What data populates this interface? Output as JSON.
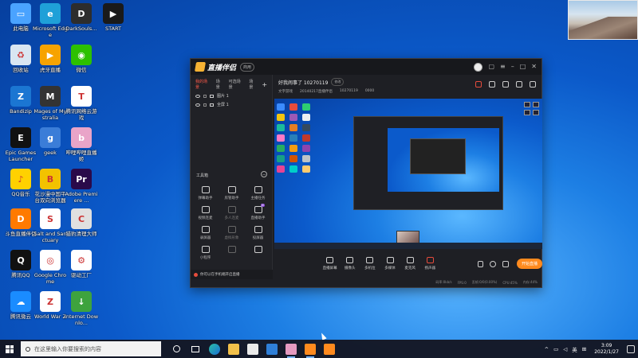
{
  "desktop": {
    "icons": [
      {
        "label": "此电脑",
        "icon": "computer-icon",
        "color": "#4aa3ff"
      },
      {
        "label": "Microsoft Edge",
        "icon": "edge-icon",
        "color": "#1fa0d8"
      },
      {
        "label": "DarkSouls...",
        "icon": "darksouls-icon",
        "color": "#2d2d2d"
      },
      {
        "label": "START",
        "icon": "start-app-icon",
        "color": "#1a1a1a"
      },
      {
        "label": "回收站",
        "icon": "recycle-bin-icon",
        "color": "#d9e6f2"
      },
      {
        "label": "虎牙直播",
        "icon": "huya-icon",
        "color": "#f7a300"
      },
      {
        "label": "微信",
        "icon": "wechat-icon",
        "color": "#2dc100"
      },
      {
        "label": "Bandizip",
        "icon": "bandizip-icon",
        "color": "#1b76d2"
      },
      {
        "label": "Mages of Mystralia",
        "icon": "mages-icon",
        "color": "#333333"
      },
      {
        "label": "腾讯网络云游戏",
        "icon": "tencent-cloud-game-icon",
        "color": "#ffffff"
      },
      {
        "label": "Epic Games Launcher",
        "icon": "epic-games-icon",
        "color": "#111111"
      },
      {
        "label": "geek",
        "icon": "geek-icon",
        "color": "#3b7dd8"
      },
      {
        "label": "哔哩哔哩直播姬",
        "icon": "bilibili-live-icon",
        "color": "#e9a4c8"
      },
      {
        "label": "QQ音乐",
        "icon": "qq-music-icon",
        "color": "#ffd100"
      },
      {
        "label": "花沙漫中国平台双向浏览器",
        "icon": "browser-icon",
        "color": "#f2c200"
      },
      {
        "label": "Adobe Premiere ...",
        "icon": "premiere-icon",
        "color": "#2a0a4a"
      },
      {
        "label": "斗鱼直播伴侣",
        "icon": "douyu-icon",
        "color": "#ff7a00"
      },
      {
        "label": "Salt and Sanctuary",
        "icon": "salt-sanctuary-icon",
        "color": "#ffffff"
      },
      {
        "label": "猎豹清理大师",
        "icon": "cleaner-icon",
        "color": "#e0e0e0"
      },
      {
        "label": "腾讯QQ",
        "icon": "qq-icon",
        "color": "#111111"
      },
      {
        "label": "Google Chrome",
        "icon": "chrome-icon",
        "color": "#ffffff"
      },
      {
        "label": "驱动工厂",
        "icon": "driver-icon",
        "color": "#ffffff"
      },
      {
        "label": "腾讯微云",
        "icon": "weiyun-icon",
        "color": "#1a8cff"
      },
      {
        "label": "World War Z",
        "icon": "wwz-icon",
        "color": "#ffffff"
      },
      {
        "label": "Internet Downlo...",
        "icon": "idm-icon",
        "color": "#3ea33e"
      }
    ]
  },
  "app": {
    "name": "直播伴侣",
    "badge": "商用",
    "scene_tabs": [
      "我的场景",
      "场景",
      "可选场景",
      "场景"
    ],
    "sources": [
      "图片 1",
      "全屏 1"
    ],
    "tools_title": "工具箱",
    "tools": [
      {
        "label": "弹幕助手",
        "dim": false,
        "new": false
      },
      {
        "label": "房管助手",
        "dim": false,
        "new": false
      },
      {
        "label": "主播任务",
        "dim": false,
        "new": false
      },
      {
        "label": "视频连麦",
        "dim": false,
        "new": false
      },
      {
        "label": "多人连麦",
        "dim": true,
        "new": false
      },
      {
        "label": "直播助手",
        "dim": false,
        "new": true
      },
      {
        "label": "录屏器",
        "dim": false,
        "new": false
      },
      {
        "label": "虚拟形象",
        "dim": true,
        "new": false
      },
      {
        "label": "投屏器",
        "dim": false,
        "new": false
      },
      {
        "label": "小程序",
        "dim": false,
        "new": false
      },
      {
        "label": "",
        "dim": true,
        "new": false
      },
      {
        "label": "",
        "dim": false,
        "new": false
      }
    ],
    "bottom_notice": "你可以在手机端开启直播",
    "room": {
      "title": "好我闹事了 10270119",
      "tag": "修改",
      "info": [
        "文字游戏",
        "20140217直播伴侣",
        "10270119",
        "0000"
      ]
    },
    "controls": [
      {
        "label": "直播屏幕"
      },
      {
        "label": "摄像头"
      },
      {
        "label": "多机位"
      },
      {
        "label": "多媒体"
      },
      {
        "label": "麦克风"
      },
      {
        "label": "扬声器"
      }
    ],
    "live_button": "开始直播",
    "status": [
      "码率:0kb/s",
      "FPS:0",
      "丢帧:0/0(0.00%)",
      "CPU:45%",
      "内存:44%"
    ]
  },
  "taskbar": {
    "search_placeholder": "在这里输入你要搜索的内容",
    "tray_lang": "英",
    "time": "3:09",
    "date": "2022/1/27"
  }
}
